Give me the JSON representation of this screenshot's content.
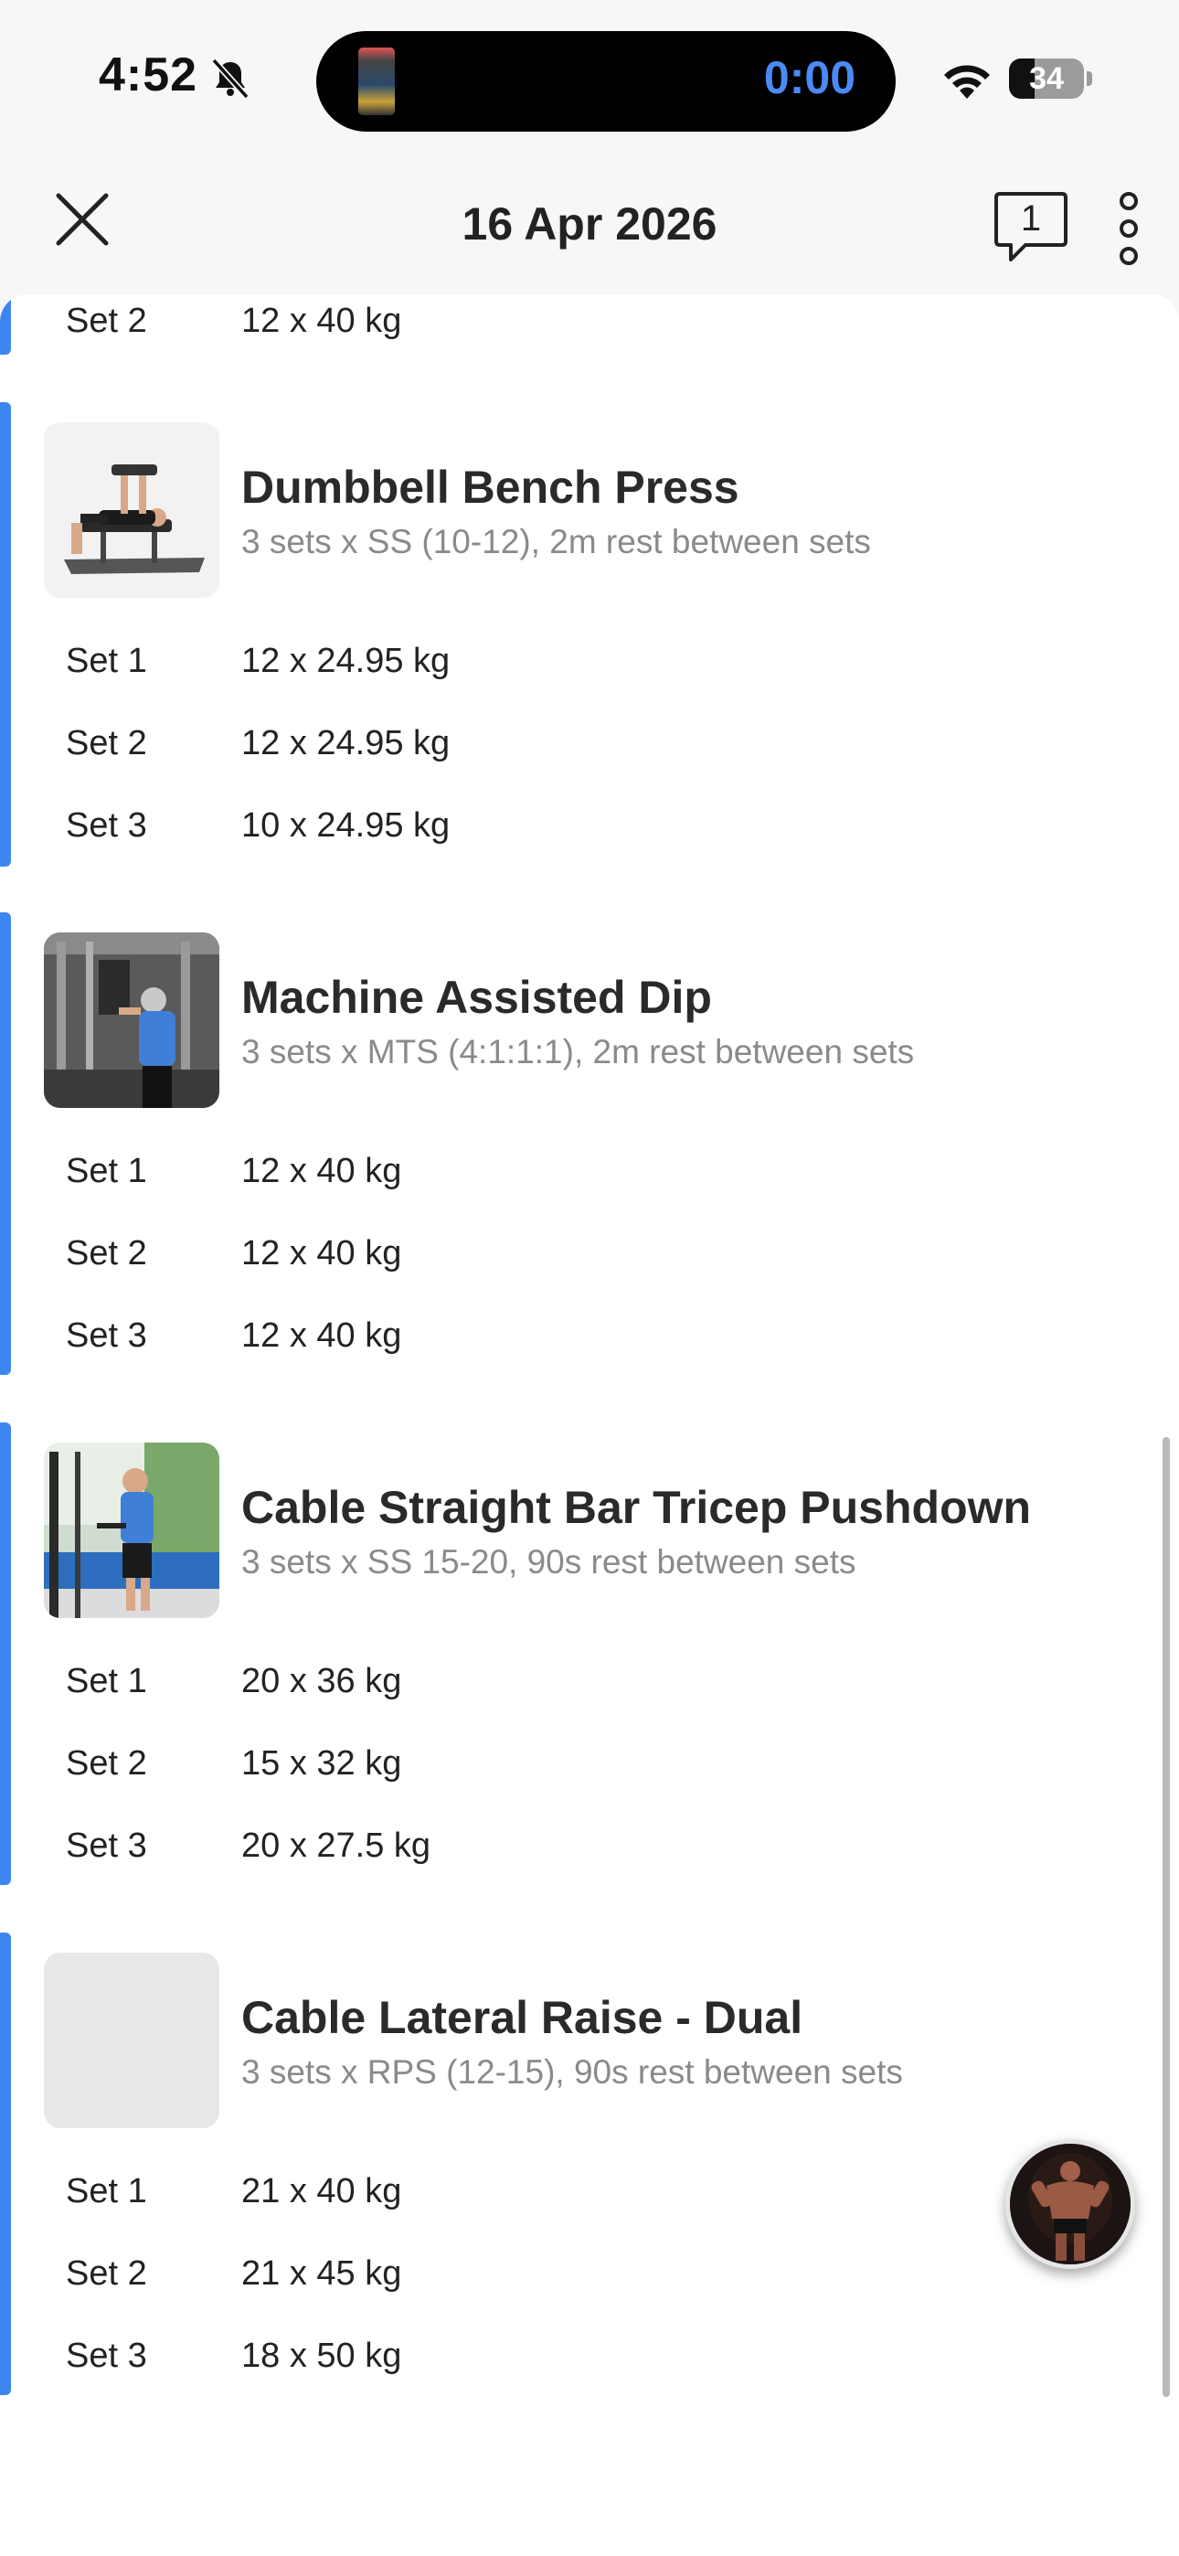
{
  "status_bar": {
    "time": "4:52",
    "timer": "0:00",
    "battery": "34",
    "battery_level_percent": 34,
    "icons": [
      "bell-slash-icon",
      "wifi-icon",
      "battery-icon"
    ]
  },
  "nav": {
    "title": "16 Apr 2026",
    "comment_count": "1",
    "icons": [
      "close-icon",
      "comment-icon",
      "more-vertical-icon"
    ]
  },
  "previous_set": {
    "label": "Set 2",
    "value": "12 x 40 kg"
  },
  "exercises": [
    {
      "name": "Dumbbell Bench Press",
      "description": "3 sets x SS (10-12), 2m rest between sets",
      "sets": [
        {
          "label": "Set 1",
          "value": "12 x 24.95 kg"
        },
        {
          "label": "Set 2",
          "value": "12 x 24.95 kg"
        },
        {
          "label": "Set 3",
          "value": "10 x 24.95 kg"
        }
      ]
    },
    {
      "name": "Machine Assisted Dip",
      "description": "3 sets x MTS (4:1:1:1), 2m rest between sets",
      "sets": [
        {
          "label": "Set 1",
          "value": "12 x 40 kg"
        },
        {
          "label": "Set 2",
          "value": "12 x 40 kg"
        },
        {
          "label": "Set 3",
          "value": "12 x 40 kg"
        }
      ]
    },
    {
      "name": "Cable Straight Bar Tricep Pushdown",
      "description": "3 sets x SS 15-20, 90s rest between sets",
      "sets": [
        {
          "label": "Set 1",
          "value": "20 x 36 kg"
        },
        {
          "label": "Set 2",
          "value": "15 x 32 kg"
        },
        {
          "label": "Set 3",
          "value": "20 x 27.5 kg"
        }
      ]
    },
    {
      "name": "Cable Lateral Raise - Dual",
      "description": "3 sets x RPS (12-15), 90s rest between sets",
      "sets": [
        {
          "label": "Set 1",
          "value": "21 x 40 kg"
        },
        {
          "label": "Set 2",
          "value": "21 x 45 kg"
        },
        {
          "label": "Set 3",
          "value": "18 x 50 kg"
        }
      ]
    }
  ],
  "colors": {
    "accent": "#3d86f0",
    "timer": "#4a8af4",
    "background": "#f7f7f7",
    "sheet": "#ffffff"
  }
}
